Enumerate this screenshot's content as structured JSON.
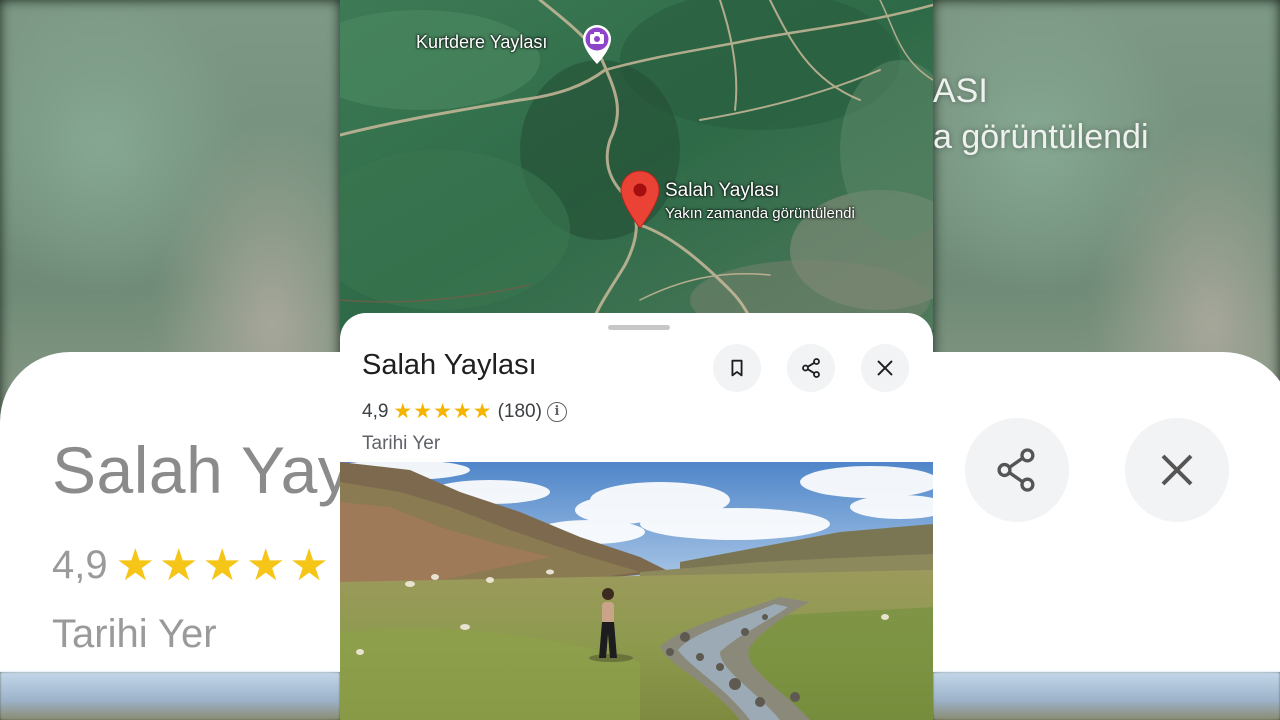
{
  "place": {
    "name": "Salah Yaylası",
    "rating": "4,9",
    "stars": "★★★★★",
    "review_count": "(180)",
    "category": "Tarihi Yer",
    "info_glyph": "i"
  },
  "map": {
    "nearby_label": "Kurtdere Yaylası",
    "pin_title": "Salah Yaylası",
    "pin_subtitle": "Yakın zamanda görüntülendi"
  },
  "actions": {
    "save": {
      "icon": "bookmark-icon"
    },
    "share": {
      "icon": "share-icon"
    },
    "close": {
      "icon": "close-icon"
    }
  },
  "background_zoom": {
    "title": "Salah Yay",
    "rating": "4,9",
    "stars": "★★★★★",
    "category": "Tarihi Yer",
    "overlay_line1": "ASI",
    "overlay_line2": "a görüntülendi"
  },
  "colors": {
    "pin_red": "#ea4335",
    "poi_purple": "#8e44c9",
    "star_yellow": "#f5b400",
    "button_bg": "#f1f3f4"
  }
}
